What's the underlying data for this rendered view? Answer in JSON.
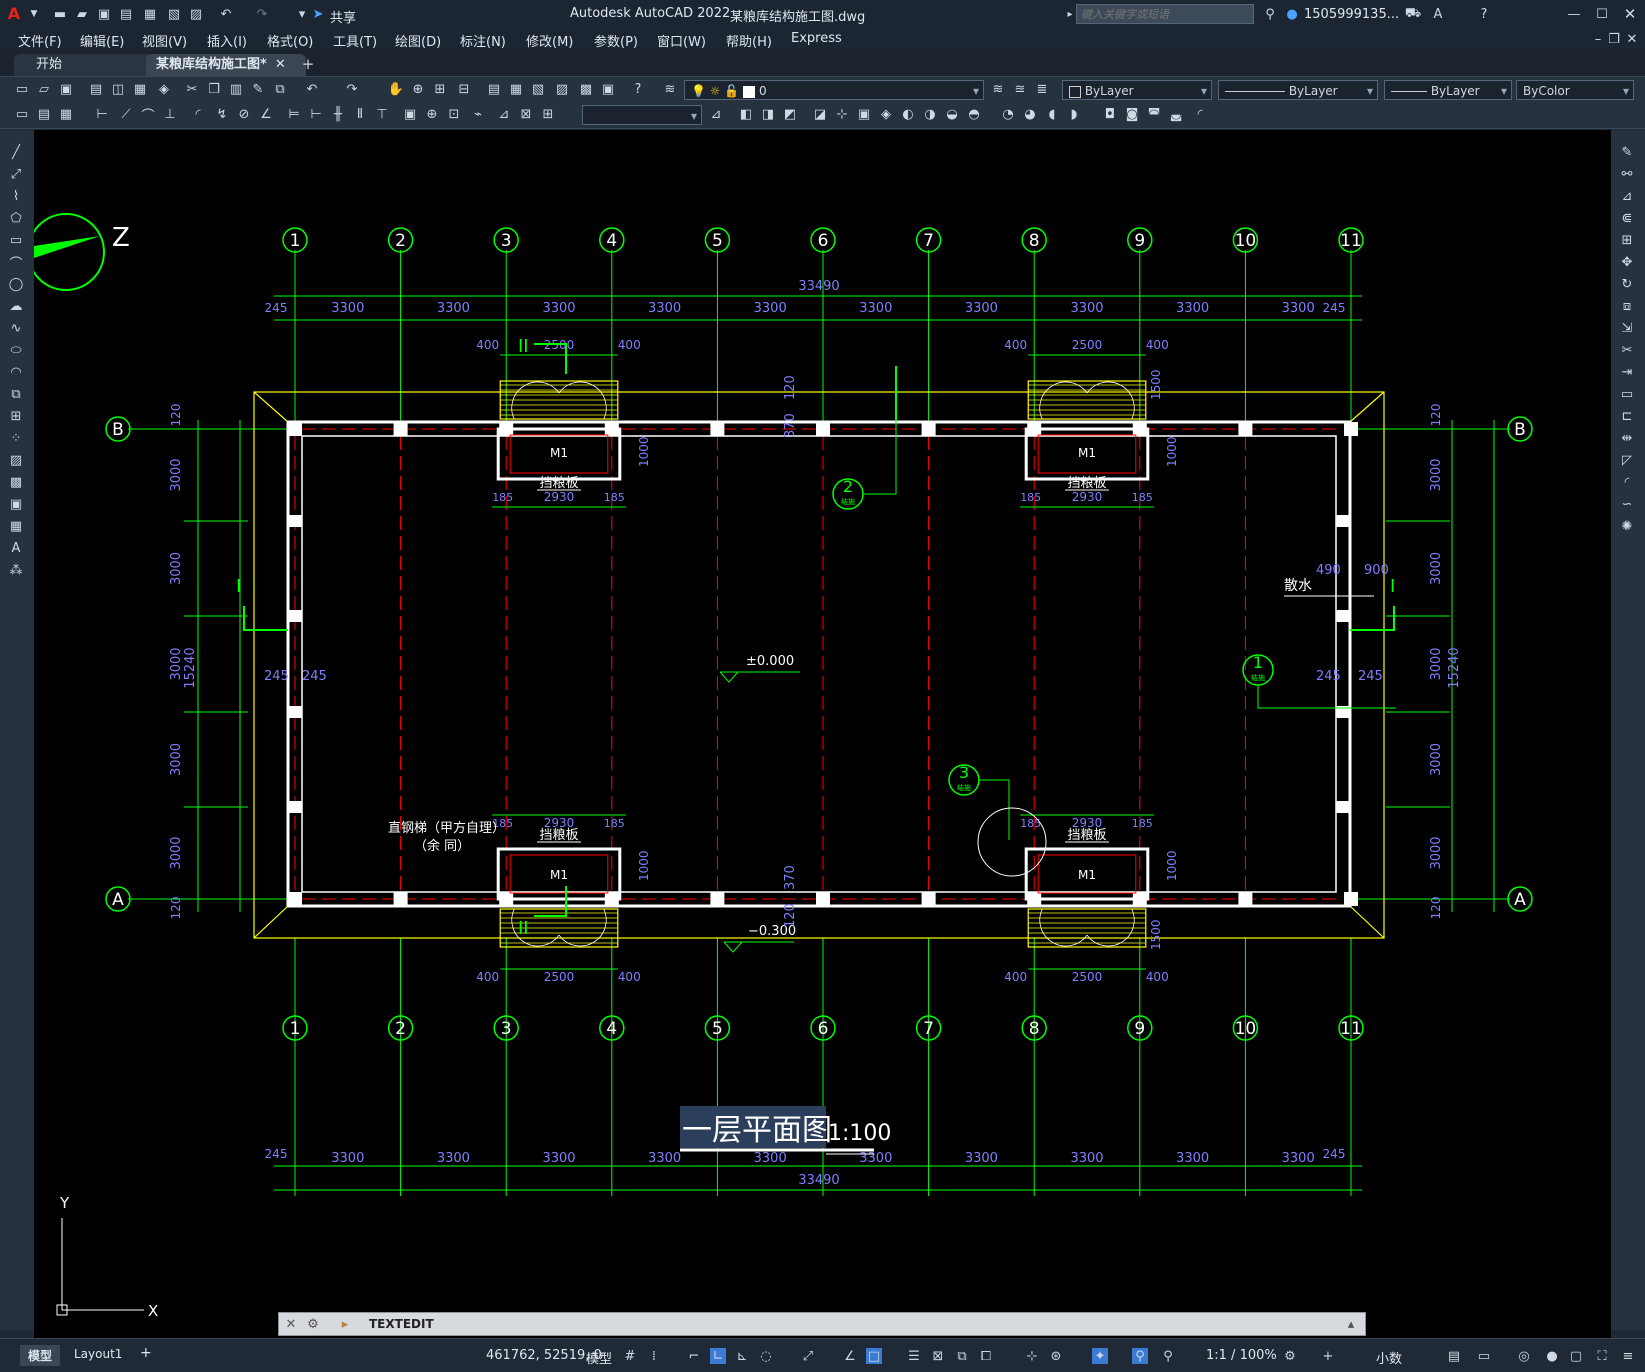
{
  "app": {
    "title": "Autodesk AutoCAD 2022",
    "filename": "某粮库结构施工图.dwg",
    "search_placeholder": "键入关键字或短语",
    "user": "1505999135...",
    "share": "共享"
  },
  "menu": [
    "文件(F)",
    "编辑(E)",
    "视图(V)",
    "插入(I)",
    "格式(O)",
    "工具(T)",
    "绘图(D)",
    "标注(N)",
    "修改(M)",
    "参数(P)",
    "窗口(W)",
    "帮助(H)",
    "Express"
  ],
  "tabs": {
    "start": "开始",
    "active": "某粮库结构施工图*",
    "add": "+"
  },
  "properties": {
    "layer": "0",
    "color": "ByLayer",
    "linetype": "ByLayer",
    "lineweight": "ByLayer",
    "plotstyle": "ByColor"
  },
  "drawing": {
    "axes_numbers": [
      "1",
      "2",
      "3",
      "4",
      "5",
      "6",
      "7",
      "8",
      "9",
      "10",
      "11"
    ],
    "axes_letters": [
      "A",
      "B"
    ],
    "total_width": "33490",
    "bay": "3300",
    "edge_offset": "245",
    "total_height": "15240",
    "row_spacing": "3000",
    "half_120": "120",
    "door_label": "M1",
    "door_width": "2500",
    "door_side": "400",
    "door_inner": "2930",
    "door_185": "185",
    "door_depth": "1000",
    "ramp_1500": "1500",
    "baffle": "挡粮板",
    "section_I": "I",
    "section_II": "II",
    "detail_1": "1",
    "detail_2": "2",
    "detail_3": "3",
    "detail_sheet": "结施",
    "elev_0": "±0.000",
    "elev_neg": "−0.300",
    "dim_370": "370",
    "dim_490": "490",
    "dim_900": "900",
    "drain": "散水",
    "ladder_1": "直钢梯（甲方自理）",
    "ladder_2": "（余   同）",
    "plan_title": "一层平面图",
    "scale": "1:100",
    "ucs_x": "X",
    "ucs_y": "Y",
    "compass": "Z"
  },
  "command": {
    "text": "TEXTEDIT"
  },
  "layout_tabs": [
    "模型",
    "Layout1",
    "+"
  ],
  "status": {
    "coords": "461762, 52519, 0",
    "model": "模型",
    "annoscale": "1:1 / 100%",
    "units": "小数"
  },
  "colors": {
    "canvas": "#000000",
    "grid_green": "#00ff00",
    "axis_red": "#ff0000",
    "dim_blue": "#7f7fff",
    "yellow": "#ffff00",
    "white": "#ffffff",
    "ui_dark": "#1f2a36"
  }
}
